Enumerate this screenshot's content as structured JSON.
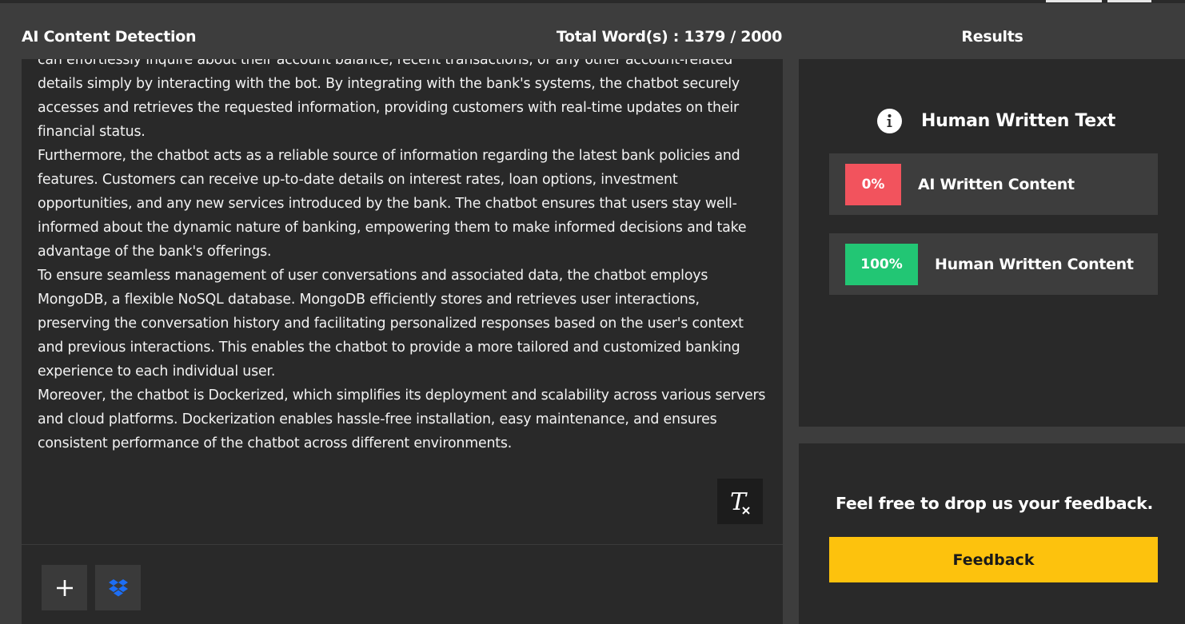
{
  "header": {
    "app_title": "AI Content Detection",
    "word_count": "Total Word(s) : 1379 / 2000",
    "results_title": "Results"
  },
  "editor": {
    "paragraphs": [
      "can effortlessly inquire about their account balance, recent transactions, or any other account-related details simply by interacting with the bot. By integrating with the bank's systems, the chatbot securely accesses and retrieves the requested information, providing customers with real-time updates on their financial status.",
      "Furthermore, the chatbot acts as a reliable source of information regarding the latest bank policies and features. Customers can receive up-to-date details on interest rates, loan options, investment opportunities, and any new services introduced by the bank. The chatbot ensures that users stay well-informed about the dynamic nature of banking, empowering them to make informed decisions and take advantage of the bank's offerings.",
      "To ensure seamless management of user conversations and associated data, the chatbot employs MongoDB, a flexible NoSQL database. MongoDB efficiently stores and retrieves user interactions, preserving the conversation history and facilitating personalized responses based on the user's context and previous interactions. This enables the chatbot to provide a more tailored and customized banking experience to each individual user.",
      "Moreover, the chatbot is Dockerized, which simplifies its deployment and scalability across various servers and cloud platforms. Dockerization enables hassle-free installation, easy maintenance, and ensures consistent performance of the chatbot across different environments."
    ],
    "tools": {
      "clear_format_icon": "clear-formatting-icon",
      "add_icon": "plus-icon",
      "dropbox_icon": "dropbox-icon"
    }
  },
  "results": {
    "verdict": "Human Written Text",
    "verdict_icon": "info-icon",
    "stats": [
      {
        "value": "0%",
        "label": "AI Written Content",
        "color": "#f2535d"
      },
      {
        "value": "100%",
        "label": "Human Written Content",
        "color": "#22c674"
      }
    ]
  },
  "feedback": {
    "prompt": "Feel free to drop us your feedback.",
    "button_label": "Feedback",
    "button_color": "#fdc20d"
  }
}
